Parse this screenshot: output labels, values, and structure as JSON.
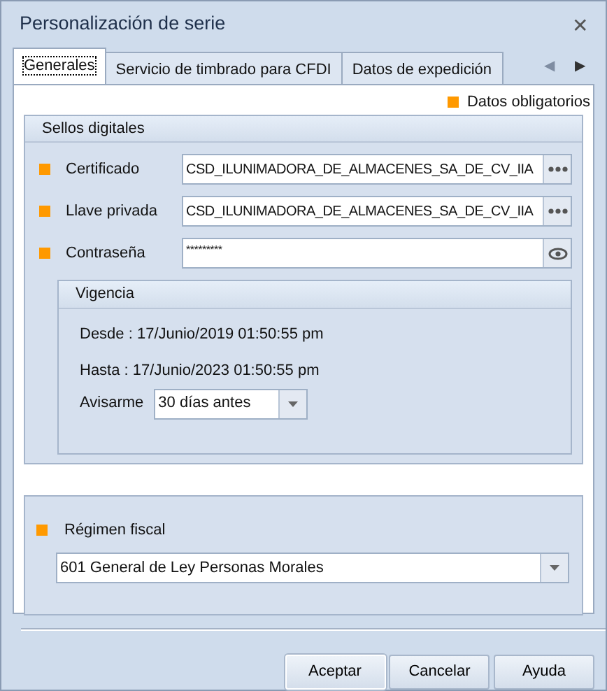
{
  "window": {
    "title": "Personalización de serie",
    "close": "✕"
  },
  "tabs": [
    {
      "label": "Generales",
      "selected": true
    },
    {
      "label": "Servicio de timbrado para CFDI",
      "selected": false
    },
    {
      "label": "Datos de expedición",
      "selected": false
    }
  ],
  "tab_scroll": {
    "prev": "◀",
    "next": "▶",
    "prev_disabled": true
  },
  "legend": {
    "label": "Datos obligatorios",
    "color": "#ff9900"
  },
  "sellos": {
    "title": "Sellos digitales",
    "fields": [
      {
        "label": "Certificado",
        "value": "CSD_ILUNIMADORA_DE_ALMACENES_SA_DE_CV_IIA",
        "kind": "browse",
        "required": true
      },
      {
        "label": "Llave privada",
        "value": "CSD_ILUNIMADORA_DE_ALMACENES_SA_DE_CV_IIA",
        "kind": "browse",
        "required": true
      },
      {
        "label": "Contraseña",
        "value": "*********",
        "kind": "password",
        "required": true
      }
    ]
  },
  "vigencia": {
    "title": "Vigencia",
    "desde": "Desde : 17/Junio/2019 01:50:55 pm",
    "hasta": "Hasta :  17/Junio/2023 01:50:55 pm",
    "avisarme_label": "Avisarme",
    "avisarme_value": "30 días antes"
  },
  "regimen": {
    "label": "Régimen fiscal",
    "required": true,
    "value": "601 General de Ley Personas Morales"
  },
  "buttons": [
    {
      "label": "Aceptar",
      "default": true
    },
    {
      "label": "Cancelar",
      "default": false
    },
    {
      "label": "Ayuda",
      "default": false
    }
  ]
}
